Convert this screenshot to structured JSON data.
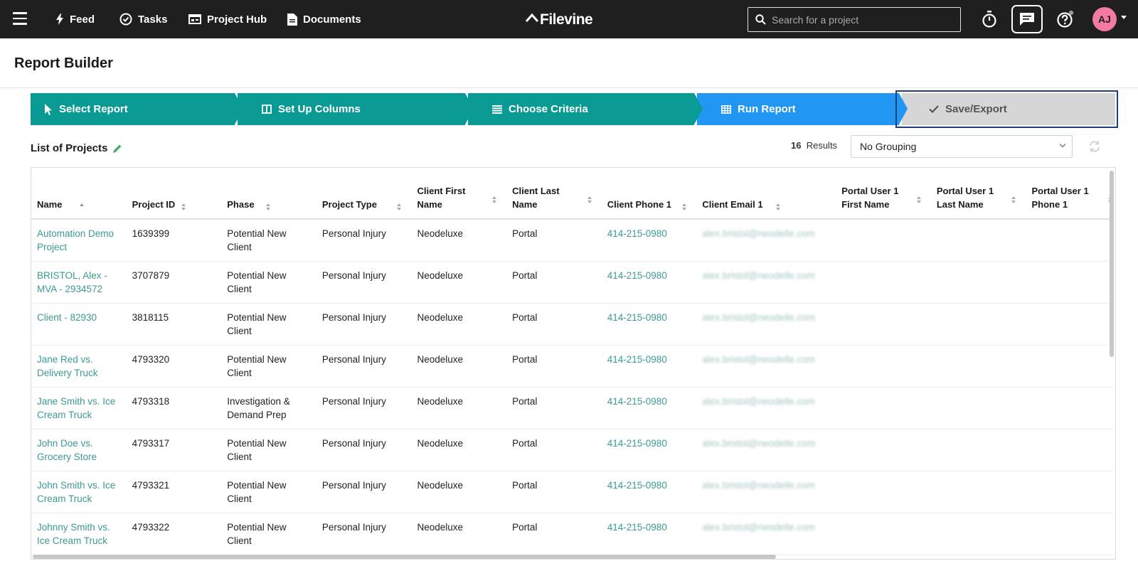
{
  "nav": {
    "items": [
      {
        "label": "Feed",
        "icon": "bolt-icon"
      },
      {
        "label": "Tasks",
        "icon": "check-circle-icon"
      },
      {
        "label": "Project Hub",
        "icon": "project-hub-icon"
      },
      {
        "label": "Documents",
        "icon": "document-icon"
      }
    ],
    "logo_text": "Filevine",
    "search_placeholder": "Search for a project",
    "avatar_initials": "AJ"
  },
  "page": {
    "title": "Report Builder"
  },
  "steps": [
    {
      "label": "Select Report",
      "icon": "cursor-icon",
      "state": "complete"
    },
    {
      "label": "Set Up Columns",
      "icon": "columns-icon",
      "state": "complete"
    },
    {
      "label": "Choose Criteria",
      "icon": "list-icon",
      "state": "complete"
    },
    {
      "label": "Run Report",
      "icon": "table-icon",
      "state": "active"
    },
    {
      "label": "Save/Export",
      "icon": "check-icon",
      "state": "pending"
    }
  ],
  "colors": {
    "teal": "#0a9a94",
    "blue": "#2196f3",
    "gray": "#d6d6d6",
    "link": "#3b9a94",
    "avatar": "#f37aa0"
  },
  "report": {
    "title": "List of Projects",
    "results_count": "16",
    "results_label": "Results",
    "grouping_value": "No Grouping"
  },
  "table": {
    "columns": [
      {
        "label": "Name"
      },
      {
        "label": "Project ID"
      },
      {
        "label": "Phase"
      },
      {
        "label": "Project Type"
      },
      {
        "label": "Client First Name"
      },
      {
        "label": "Client Last Name"
      },
      {
        "label": "Client Phone 1"
      },
      {
        "label": "Client Email 1"
      },
      {
        "label": "Portal User 1 First Name"
      },
      {
        "label": "Portal User 1 Last Name"
      },
      {
        "label": "Portal User 1 Phone 1"
      }
    ],
    "rows": [
      {
        "name": "Automation Demo Project",
        "id": "1639399",
        "phase": "Potential New Client",
        "type": "Personal Injury",
        "first": "Neodeluxe",
        "last": "Portal",
        "phone": "414-215-0980",
        "email": "alex.bristol@neodelle.com"
      },
      {
        "name": "BRISTOL, Alex - MVA - 2934572",
        "id": "3707879",
        "phase": "Potential New Client",
        "type": "Personal Injury",
        "first": "Neodeluxe",
        "last": "Portal",
        "phone": "414-215-0980",
        "email": "alex.bristol@neodelle.com"
      },
      {
        "name": "Client - 82930",
        "id": "3818115",
        "phase": "Potential New Client",
        "type": "Personal Injury",
        "first": "Neodeluxe",
        "last": "Portal",
        "phone": "414-215-0980",
        "email": "alex.bristol@neodelle.com"
      },
      {
        "name": "Jane Red vs. Delivery Truck",
        "id": "4793320",
        "phase": "Potential New Client",
        "type": "Personal Injury",
        "first": "Neodeluxe",
        "last": "Portal",
        "phone": "414-215-0980",
        "email": "alex.bristol@neodelle.com"
      },
      {
        "name": "Jane Smith vs. Ice Cream Truck",
        "id": "4793318",
        "phase": "Investigation & Demand Prep",
        "type": "Personal Injury",
        "first": "Neodeluxe",
        "last": "Portal",
        "phone": "414-215-0980",
        "email": "alex.bristol@neodelle.com"
      },
      {
        "name": "John Doe vs. Grocery Store",
        "id": "4793317",
        "phase": "Potential New Client",
        "type": "Personal Injury",
        "first": "Neodeluxe",
        "last": "Portal",
        "phone": "414-215-0980",
        "email": "alex.bristol@neodelle.com"
      },
      {
        "name": "John Smith vs. Ice Cream Truck",
        "id": "4793321",
        "phase": "Potential New Client",
        "type": "Personal Injury",
        "first": "Neodeluxe",
        "last": "Portal",
        "phone": "414-215-0980",
        "email": "alex.bristol@neodelle.com"
      },
      {
        "name": "Johnny Smith vs. Ice Cream Truck",
        "id": "4793322",
        "phase": "Potential New Client",
        "type": "Personal Injury",
        "first": "Neodeluxe",
        "last": "Portal",
        "phone": "414-215-0980",
        "email": "alex.bristol@neodelle.com"
      }
    ]
  }
}
